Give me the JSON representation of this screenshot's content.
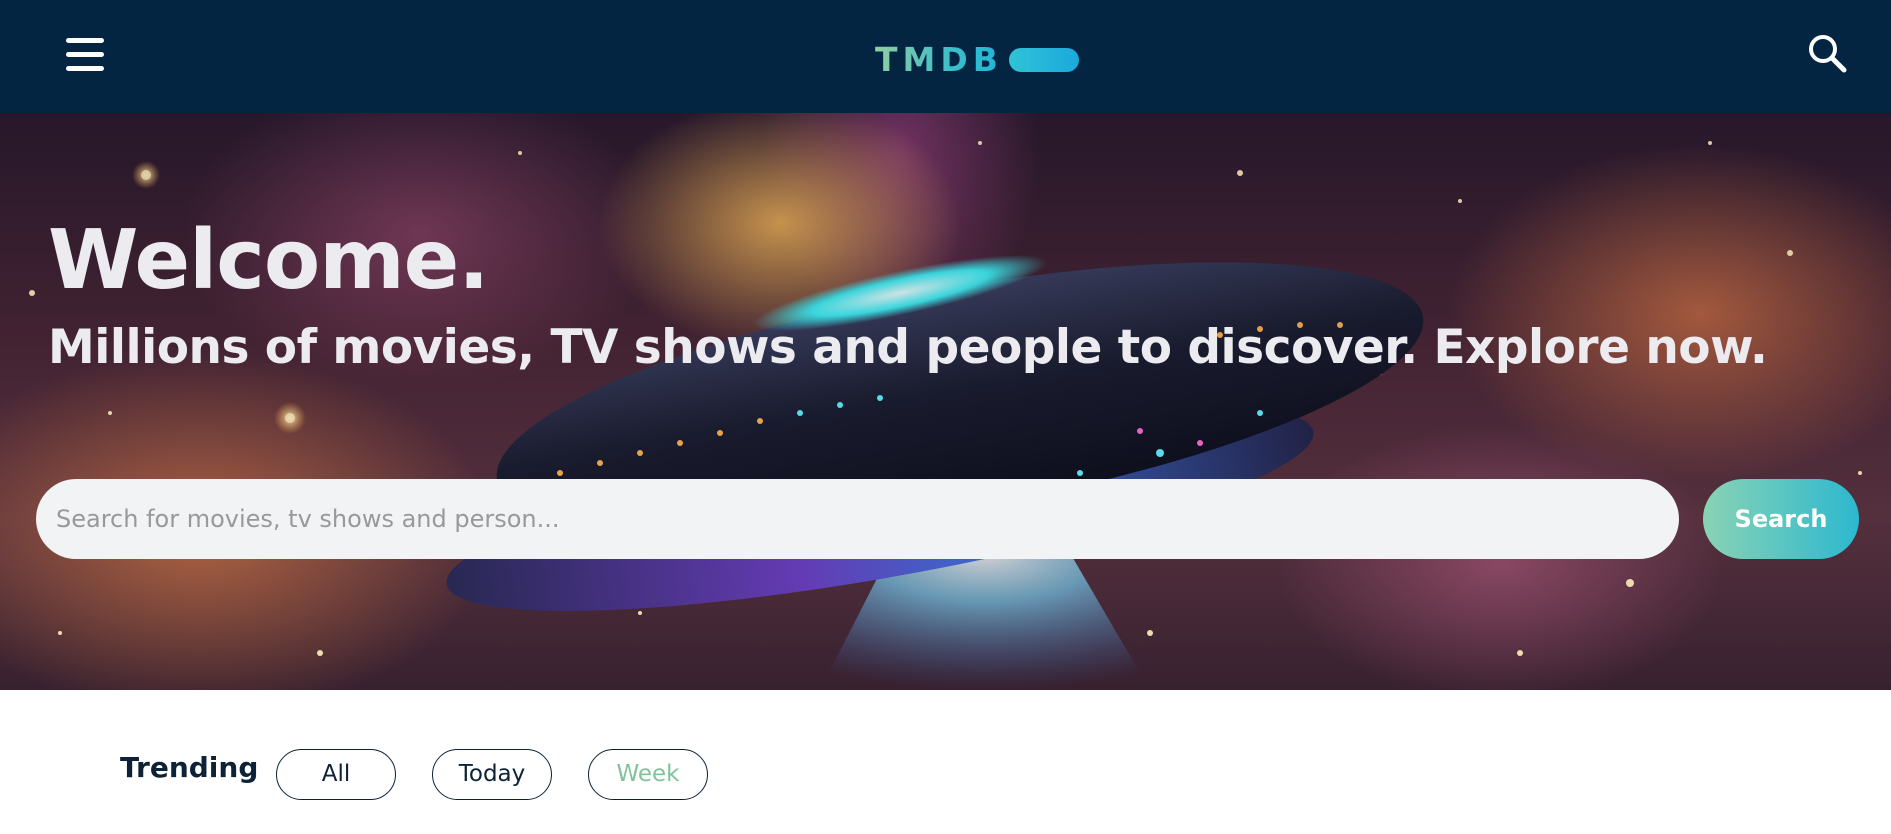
{
  "header": {
    "menu_icon": "hamburger-menu-icon",
    "logo_text": "TMDB",
    "search_icon": "search-icon",
    "bg_color": "#032541"
  },
  "hero": {
    "title": "Welcome.",
    "subtitle": "Millions of movies, TV shows and people to discover. Explore now.",
    "search": {
      "placeholder": "Search for movies, tv shows and person...",
      "value": "",
      "button_label": "Search"
    }
  },
  "trending": {
    "label": "Trending",
    "tabs": [
      {
        "label": "All",
        "active": false
      },
      {
        "label": "Today",
        "active": false
      },
      {
        "label": "Week",
        "active": true
      }
    ],
    "active_color": "#80c39a"
  }
}
